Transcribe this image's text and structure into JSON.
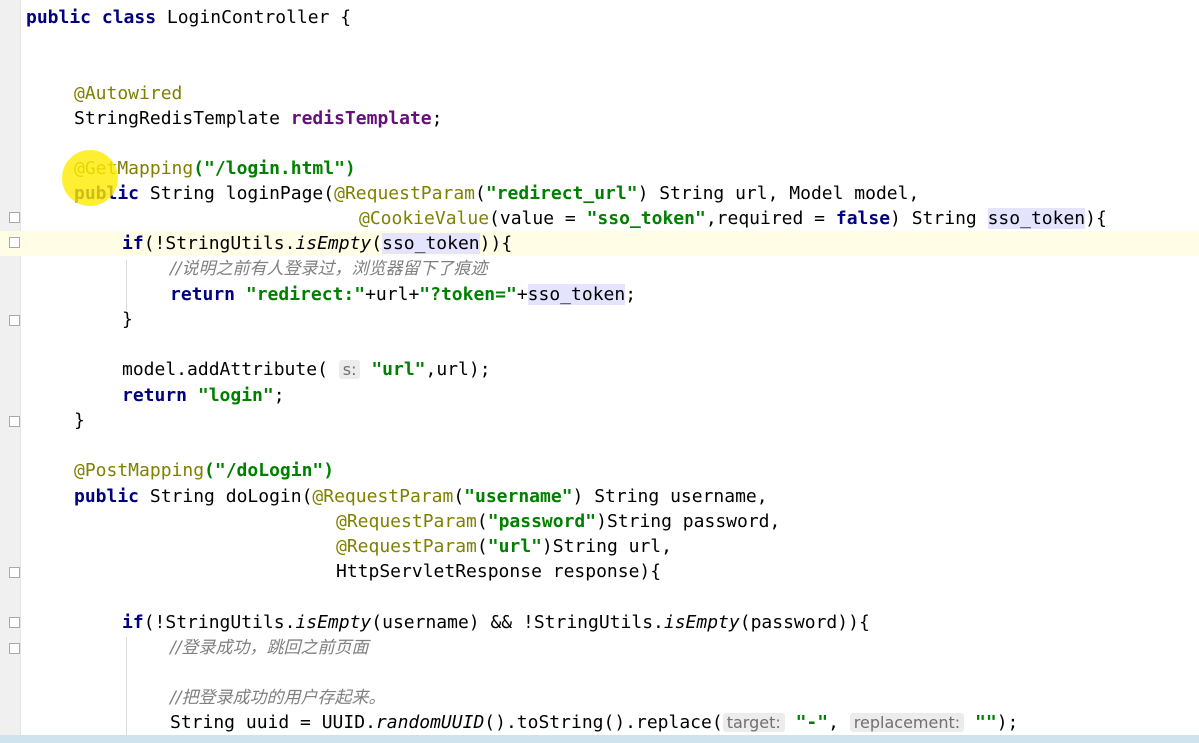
{
  "colors": {
    "keyword": "#000080",
    "annotation": "#808000",
    "string": "#008000",
    "field": "#660e7a",
    "comment": "#808080",
    "cursor_highlight": "#ffeb00"
  },
  "code": {
    "class_kw": "public class",
    "class_name": " LoginController {",
    "autowired": "@Autowired",
    "redis_type": "StringRedisTemplate ",
    "redis_field": "redisTemplate",
    "semicolon": ";",
    "getmapping": "@GetMapping",
    "getmapping_arg": "(\"/login.html\")",
    "l1_public": "public",
    "l1_sig": " String loginPage(",
    "reqparam": "@RequestParam",
    "l1_p1_open": "(",
    "l1_p1_str": "\"redirect_url\"",
    "l1_p1_rest": ") String url, Model model,",
    "cookievalue": "@CookieValue",
    "l2_mid": "(value = ",
    "l2_str": "\"sso_token\"",
    "l2_req": ",required = ",
    "false_kw": "false",
    "l2_type": ") String ",
    "l2_param": "sso_token",
    "l2_end": "){",
    "if_kw": "if",
    "if1_open": "(!StringUtils.",
    "isempty": "isEmpty",
    "if1_arg": "sso_token",
    "if1_end": ")){",
    "comment1": "//说明之前有人登录过，浏览器留下了痕迹",
    "return_kw": "return",
    "ret1_str1": "\"redirect:\"",
    "ret1_mid1": "+url+",
    "ret1_str2": "\"?token=\"",
    "ret1_mid2": "+",
    "ret1_var": "sso_token",
    "ret1_end": ";",
    "close_brace": "}",
    "model_call": "model.addAttribute(",
    "hint_s": "s:",
    "model_str": "\"url\"",
    "model_end": ",url);",
    "ret2_str": "\"login\"",
    "postmapping": "@PostMapping",
    "postmapping_arg": "(\"/doLogin\")",
    "dologin_sig": " String doLogin(",
    "p_user_str": "\"username\"",
    "p_user_rest": ") String username,",
    "p_pass_str": "\"password\"",
    "p_pass_rest": ")String password,",
    "p_url_str": "\"url\"",
    "p_url_rest": ")String url,",
    "p_resp": "HttpServletResponse response){",
    "if2_open": "(!StringUtils.",
    "if2_mid": "(username) && !StringUtils.",
    "if2_end": "(password)){",
    "comment2": "//登录成功，跳回之前页面",
    "comment3": "//把登录成功的用户存起来。",
    "uuid_decl": "String uuid = UUID.",
    "randomuuid": "randomUUID",
    "uuid_mid": "().toString().replace(",
    "hint_target": "target:",
    "dash_str": "\"-\"",
    "comma": ",",
    "hint_replacement": "replacement:",
    "empty_str": "\"\"",
    "uuid_end": ");"
  }
}
